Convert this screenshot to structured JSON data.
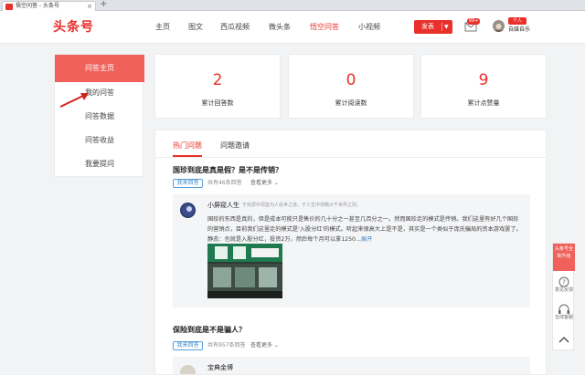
{
  "browser_tab": {
    "title": "悟空问答 - 头条号",
    "close": "×",
    "new_tab": "+"
  },
  "header": {
    "logo": "头条号",
    "nav": [
      {
        "label": "主页",
        "active": false
      },
      {
        "label": "图文",
        "active": false
      },
      {
        "label": "西瓜视频",
        "active": false
      },
      {
        "label": "微头条",
        "active": false
      },
      {
        "label": "悟空问答",
        "active": true
      },
      {
        "label": "小视频",
        "active": false
      }
    ],
    "publish_label": "发表",
    "message_badge": "99+",
    "user_badge": "个人",
    "user_name": "自媒自乐"
  },
  "sidebar": {
    "home": "问答主页",
    "items": [
      "我的问答",
      "问答数据",
      "问答收益",
      "我要提问"
    ]
  },
  "stats": [
    {
      "value": "2",
      "label": "累计回答数"
    },
    {
      "value": "0",
      "label": "累计阅读数"
    },
    {
      "value": "9",
      "label": "累计点赞量"
    }
  ],
  "tabs": [
    "热门问题",
    "问题邀请"
  ],
  "questions": [
    {
      "title": "国珍到底是真是假？是不是传销？",
      "answer_button": "我来回答",
      "count": "共有46条回答",
      "more": "查看更多",
      "answer": {
        "author": "小屏窥人生",
        "author_desc": "于完屏中领鉴为人处世之道，于人生中领略大千世界之别。",
        "text": "国珍的东西是真的，但是成本可能只是售价的几十分之一甚至几百分之一。然而国珍走的模式是传销。我们这里有好几个国珍的营销点，目前我们这里走的模式是'入股分红'的模式。听起来很高大上是不是，其实是一个类似于庞氏骗局的资本游戏罢了。静态：也就是入股分红，投资2万，然后每个月可以拿1250...",
        "expand": "展开"
      }
    },
    {
      "title": "保险到底是不是骗人？",
      "answer_button": "我来回答",
      "count": "共有957条回答",
      "more": "查看更多",
      "answer": {
        "author": "宝典金博"
      }
    }
  ],
  "float_bar": {
    "promo": "头条号全新升级",
    "feedback": "意见反馈",
    "support": "在线客服"
  },
  "colors": {
    "accent": "#e9302b",
    "sidebar_head": "#f0615c",
    "link": "#3a87c9"
  }
}
